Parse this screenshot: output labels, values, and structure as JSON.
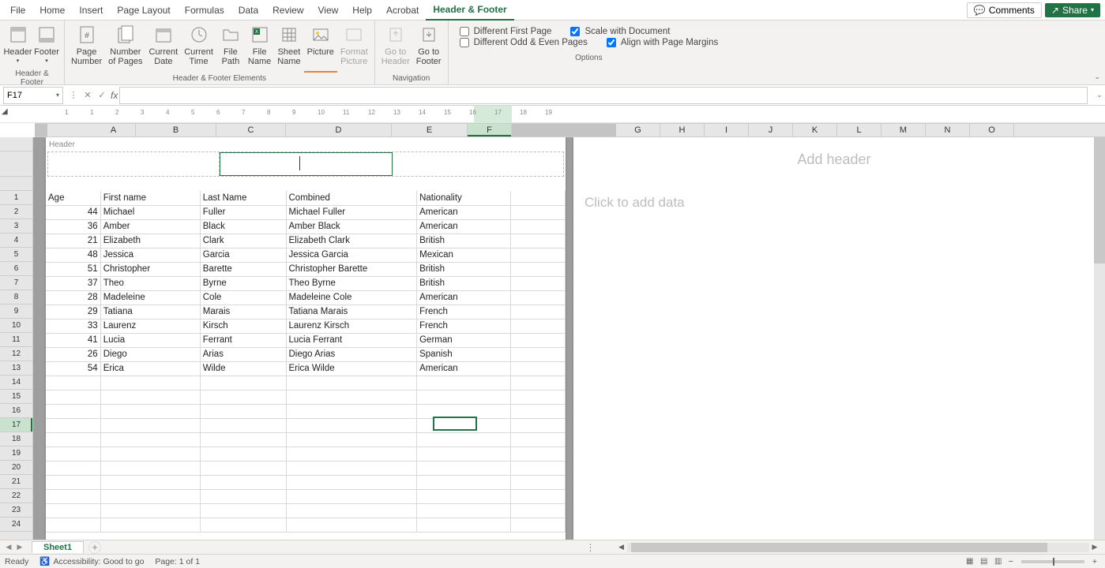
{
  "menu": {
    "items": [
      "File",
      "Home",
      "Insert",
      "Page Layout",
      "Formulas",
      "Data",
      "Review",
      "View",
      "Help",
      "Acrobat",
      "Header & Footer"
    ],
    "active_index": 10,
    "comments": "Comments",
    "share": "Share"
  },
  "ribbon": {
    "group_labels": [
      "Header & Footer",
      "Header & Footer Elements",
      "Navigation",
      "Options"
    ],
    "hf": {
      "header": "Header",
      "footer": "Footer"
    },
    "elements": {
      "page_number": "Page\nNumber",
      "num_pages": "Number\nof Pages",
      "cur_date": "Current\nDate",
      "cur_time": "Current\nTime",
      "file_path": "File\nPath",
      "file_name": "File\nName",
      "sheet_name": "Sheet\nName",
      "picture": "Picture",
      "format_picture": "Format\nPicture"
    },
    "nav": {
      "goto_header": "Go to\nHeader",
      "goto_footer": "Go to\nFooter"
    },
    "options": {
      "diff_first": "Different First Page",
      "diff_odd": "Different Odd & Even Pages",
      "scale": "Scale with Document",
      "align": "Align with Page Margins",
      "diff_first_checked": false,
      "diff_odd_checked": false,
      "scale_checked": true,
      "align_checked": true
    }
  },
  "formula_bar": {
    "cell_ref": "F17",
    "formula": ""
  },
  "ruler": {
    "marks": [
      "1",
      "1",
      "2",
      "3",
      "4",
      "5",
      "6",
      "7",
      "8",
      "9",
      "10",
      "11",
      "12",
      "13",
      "14",
      "15",
      "16",
      "17",
      "18",
      "19"
    ]
  },
  "columns_left": [
    "A",
    "B",
    "C",
    "D",
    "E",
    "F"
  ],
  "columns_right": [
    "G",
    "H",
    "I",
    "J",
    "K",
    "L",
    "M",
    "N",
    "O"
  ],
  "row_numbers": [
    1,
    2,
    3,
    4,
    5,
    6,
    7,
    8,
    9,
    10,
    11,
    12,
    13,
    14,
    15,
    16,
    17,
    18,
    19,
    20,
    21,
    22,
    23,
    24
  ],
  "header_section_label": "Header",
  "add_header_text": "Add header",
  "click_data_text": "Click to add data",
  "table": {
    "headers": [
      "Age",
      "First name",
      "Last Name",
      "Combined",
      "Nationality",
      ""
    ],
    "rows": [
      [
        "44",
        "Michael",
        "Fuller",
        "Michael Fuller",
        "American",
        ""
      ],
      [
        "36",
        "Amber",
        "Black",
        "Amber  Black",
        "American",
        ""
      ],
      [
        "21",
        "Elizabeth",
        "Clark",
        "Elizabeth  Clark",
        "British",
        ""
      ],
      [
        "48",
        "Jessica",
        "Garcia",
        "Jessica Garcia",
        "Mexican",
        ""
      ],
      [
        "51",
        "Christopher",
        "Barette",
        "Christopher Barette",
        "British",
        ""
      ],
      [
        "37",
        "Theo",
        "Byrne",
        "Theo Byrne",
        "British",
        ""
      ],
      [
        "28",
        "Madeleine",
        "Cole",
        "Madeleine Cole",
        "American",
        ""
      ],
      [
        "29",
        "Tatiana",
        "Marais",
        "Tatiana Marais",
        "French",
        ""
      ],
      [
        "33",
        "Laurenz",
        "Kirsch",
        "Laurenz Kirsch",
        "French",
        ""
      ],
      [
        "41",
        "Lucia",
        "Ferrant",
        "Lucia Ferrant",
        "German",
        ""
      ],
      [
        "26",
        "Diego",
        "Arias",
        "Diego Arias",
        "Spanish",
        ""
      ],
      [
        "54",
        "Erica",
        "Wilde",
        "Erica Wilde",
        "American",
        ""
      ]
    ]
  },
  "sheet_tabs": {
    "active": "Sheet1"
  },
  "status": {
    "ready": "Ready",
    "accessibility": "Accessibility: Good to go",
    "page": "Page: 1 of 1"
  },
  "selected_cell": {
    "col": "F",
    "row": 17
  },
  "chart_data": {
    "type": "table",
    "headers": [
      "Age",
      "First name",
      "Last Name",
      "Combined",
      "Nationality"
    ],
    "rows": [
      [
        44,
        "Michael",
        "Fuller",
        "Michael Fuller",
        "American"
      ],
      [
        36,
        "Amber",
        "Black",
        "Amber  Black",
        "American"
      ],
      [
        21,
        "Elizabeth",
        "Clark",
        "Elizabeth  Clark",
        "British"
      ],
      [
        48,
        "Jessica",
        "Garcia",
        "Jessica Garcia",
        "Mexican"
      ],
      [
        51,
        "Christopher",
        "Barette",
        "Christopher Barette",
        "British"
      ],
      [
        37,
        "Theo",
        "Byrne",
        "Theo Byrne",
        "British"
      ],
      [
        28,
        "Madeleine",
        "Cole",
        "Madeleine Cole",
        "American"
      ],
      [
        29,
        "Tatiana",
        "Marais",
        "Tatiana Marais",
        "French"
      ],
      [
        33,
        "Laurenz",
        "Kirsch",
        "Laurenz Kirsch",
        "French"
      ],
      [
        41,
        "Lucia",
        "Ferrant",
        "Lucia Ferrant",
        "German"
      ],
      [
        26,
        "Diego",
        "Arias",
        "Diego Arias",
        "Spanish"
      ],
      [
        54,
        "Erica",
        "Wilde",
        "Erica Wilde",
        "American"
      ]
    ]
  }
}
